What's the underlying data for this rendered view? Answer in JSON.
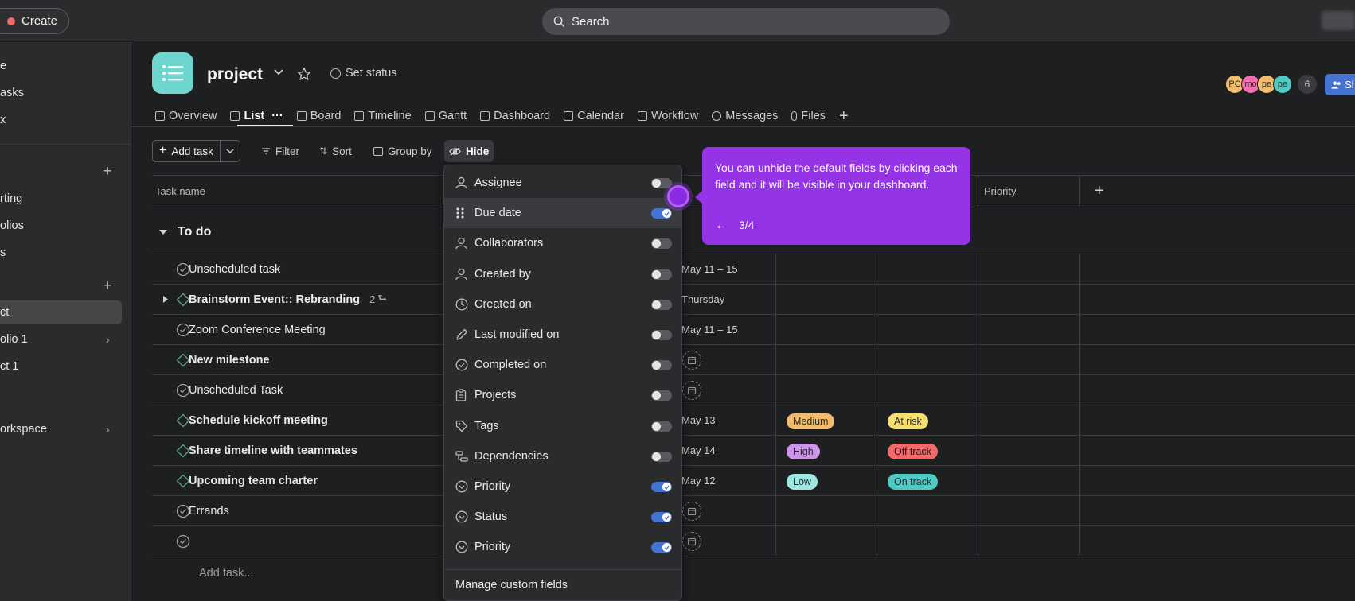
{
  "topbar": {
    "create_label": "Create",
    "search_placeholder": "Search"
  },
  "sidebar": {
    "items": [
      {
        "label": "e"
      },
      {
        "label": "asks"
      },
      {
        "label": "x"
      },
      {
        "label": "rting"
      },
      {
        "label": "olios"
      },
      {
        "label": "s"
      },
      {
        "label": "ct"
      },
      {
        "label": "olio 1"
      },
      {
        "label": "ct 1"
      },
      {
        "label": "orkspace"
      }
    ]
  },
  "header": {
    "project_title": "project",
    "set_status_label": "Set status",
    "avatars": [
      {
        "initials": "PC",
        "color": "#f1bd6c"
      },
      {
        "initials": "mo",
        "color": "#f26fb2"
      },
      {
        "initials": "pe",
        "color": "#f1bd6c"
      },
      {
        "initials": "pe",
        "color": "#4ecbc4"
      }
    ],
    "member_count": "6",
    "share_label": "Sh"
  },
  "tabs": [
    {
      "label": "Overview"
    },
    {
      "label": "List"
    },
    {
      "label": "Board"
    },
    {
      "label": "Timeline"
    },
    {
      "label": "Gantt"
    },
    {
      "label": "Dashboard"
    },
    {
      "label": "Calendar"
    },
    {
      "label": "Workflow"
    },
    {
      "label": "Messages"
    },
    {
      "label": "Files"
    }
  ],
  "list_tab_more": "···",
  "toolbar": {
    "add_task_label": "Add task",
    "filter_label": "Filter",
    "sort_label": "Sort",
    "group_by_label": "Group by",
    "hide_label": "Hide"
  },
  "table": {
    "col_task_name": "Task name",
    "col_priority": "Priority",
    "section_title": "To do",
    "rows": [
      {
        "name": "Unscheduled task",
        "due": "May 11 – 15"
      },
      {
        "name": "Brainstorm Event:: Rebranding",
        "due": "Thursday",
        "subtasks": "2"
      },
      {
        "name": "Zoom Conference Meeting",
        "due": "May 11 – 15"
      },
      {
        "name": "New milestone",
        "due": ""
      },
      {
        "name": "Unscheduled Task",
        "due": ""
      },
      {
        "name": "Schedule kickoff meeting",
        "due": "May 13",
        "priority": "Medium",
        "status": "At risk"
      },
      {
        "name": "Share timeline with teammates",
        "due": "May 14",
        "priority": "High",
        "status": "Off track"
      },
      {
        "name": "Upcoming team charter",
        "due": "May 12",
        "priority": "Low",
        "status": "On track"
      },
      {
        "name": "Errands",
        "due": ""
      },
      {
        "name": "",
        "due": ""
      }
    ],
    "add_task_row": "Add task..."
  },
  "pill_colors": {
    "Medium": "#f1bd6c",
    "High": "#cd95ea",
    "Low": "#9ee7e3",
    "At risk": "#f8df72",
    "Off track": "#f06a6a",
    "On track": "#4ecbc4"
  },
  "hide_menu": {
    "items": [
      {
        "label": "Assignee",
        "on": false
      },
      {
        "label": "Due date",
        "on": true
      },
      {
        "label": "Collaborators",
        "on": false
      },
      {
        "label": "Created by",
        "on": false
      },
      {
        "label": "Created on",
        "on": false
      },
      {
        "label": "Last modified on",
        "on": false
      },
      {
        "label": "Completed on",
        "on": false
      },
      {
        "label": "Projects",
        "on": false
      },
      {
        "label": "Tags",
        "on": false
      },
      {
        "label": "Dependencies",
        "on": false
      },
      {
        "label": "Priority",
        "on": true
      },
      {
        "label": "Status",
        "on": true
      },
      {
        "label": "Priority",
        "on": true
      }
    ],
    "manage_label": "Manage custom fields"
  },
  "tooltip": {
    "text": "You can unhide the default fields by clicking each field and it will be visible in your dashboard.",
    "step": "3/4"
  }
}
